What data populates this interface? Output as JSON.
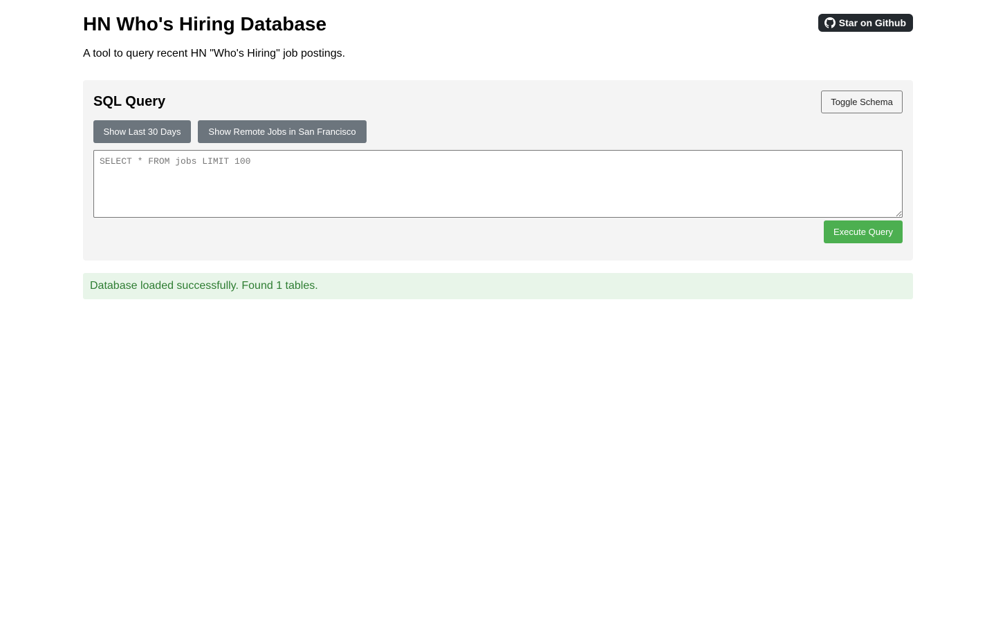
{
  "header": {
    "title": "HN Who's Hiring Database",
    "subtitle": "A tool to query recent HN \"Who's Hiring\" job postings.",
    "github_button": {
      "label": "Star on Github",
      "icon": "github-icon"
    }
  },
  "query_panel": {
    "heading": "SQL Query",
    "toggle_schema_label": "Toggle Schema",
    "preset_buttons": [
      {
        "label": "Show Last 30 Days"
      },
      {
        "label": "Show Remote Jobs in San Francisco"
      }
    ],
    "query_input": {
      "value": "",
      "placeholder": "SELECT * FROM jobs LIMIT 100"
    },
    "execute_label": "Execute Query"
  },
  "status": {
    "message": "Database loaded successfully. Found 1 tables."
  },
  "colors": {
    "github_button_bg": "#24292e",
    "panel_bg": "#f4f4f4",
    "preset_button_bg": "#6c757d",
    "execute_button_bg": "#4caf50",
    "status_bg": "#e8f5e9",
    "status_text": "#2e7d32"
  }
}
